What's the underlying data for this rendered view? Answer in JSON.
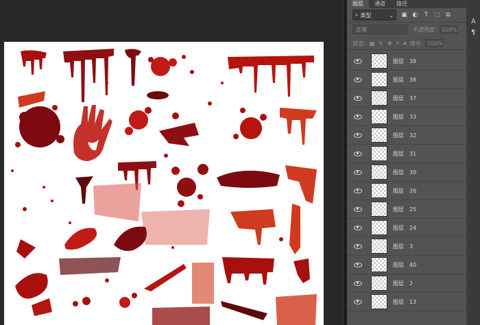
{
  "panel": {
    "tabs": [
      "图层",
      "通道",
      "路径"
    ],
    "filter": {
      "kind_label": "类型",
      "icons": [
        "image-filter-icon",
        "adjustment-filter-icon",
        "type-filter-icon",
        "shape-filter-icon",
        "smart-object-filter-icon"
      ]
    },
    "blend_mode": "正常",
    "opacity_label": "不透明度:",
    "opacity_value": "100%",
    "lock_label": "锁定:",
    "fill_label": "填充:",
    "fill_value": "100%",
    "layer_prefix": "图层",
    "layers": [
      "39",
      "38",
      "37",
      "33",
      "32",
      "31",
      "30",
      "26",
      "25",
      "24",
      "3",
      "40",
      "2",
      "13"
    ]
  },
  "right_strip": {
    "icons": [
      "character-panel-icon",
      "paragraph-panel-icon"
    ]
  },
  "colors": {
    "blood_dark": "#7a0d0d",
    "blood": "#b3140f",
    "blood_light": "#d23b1c"
  }
}
